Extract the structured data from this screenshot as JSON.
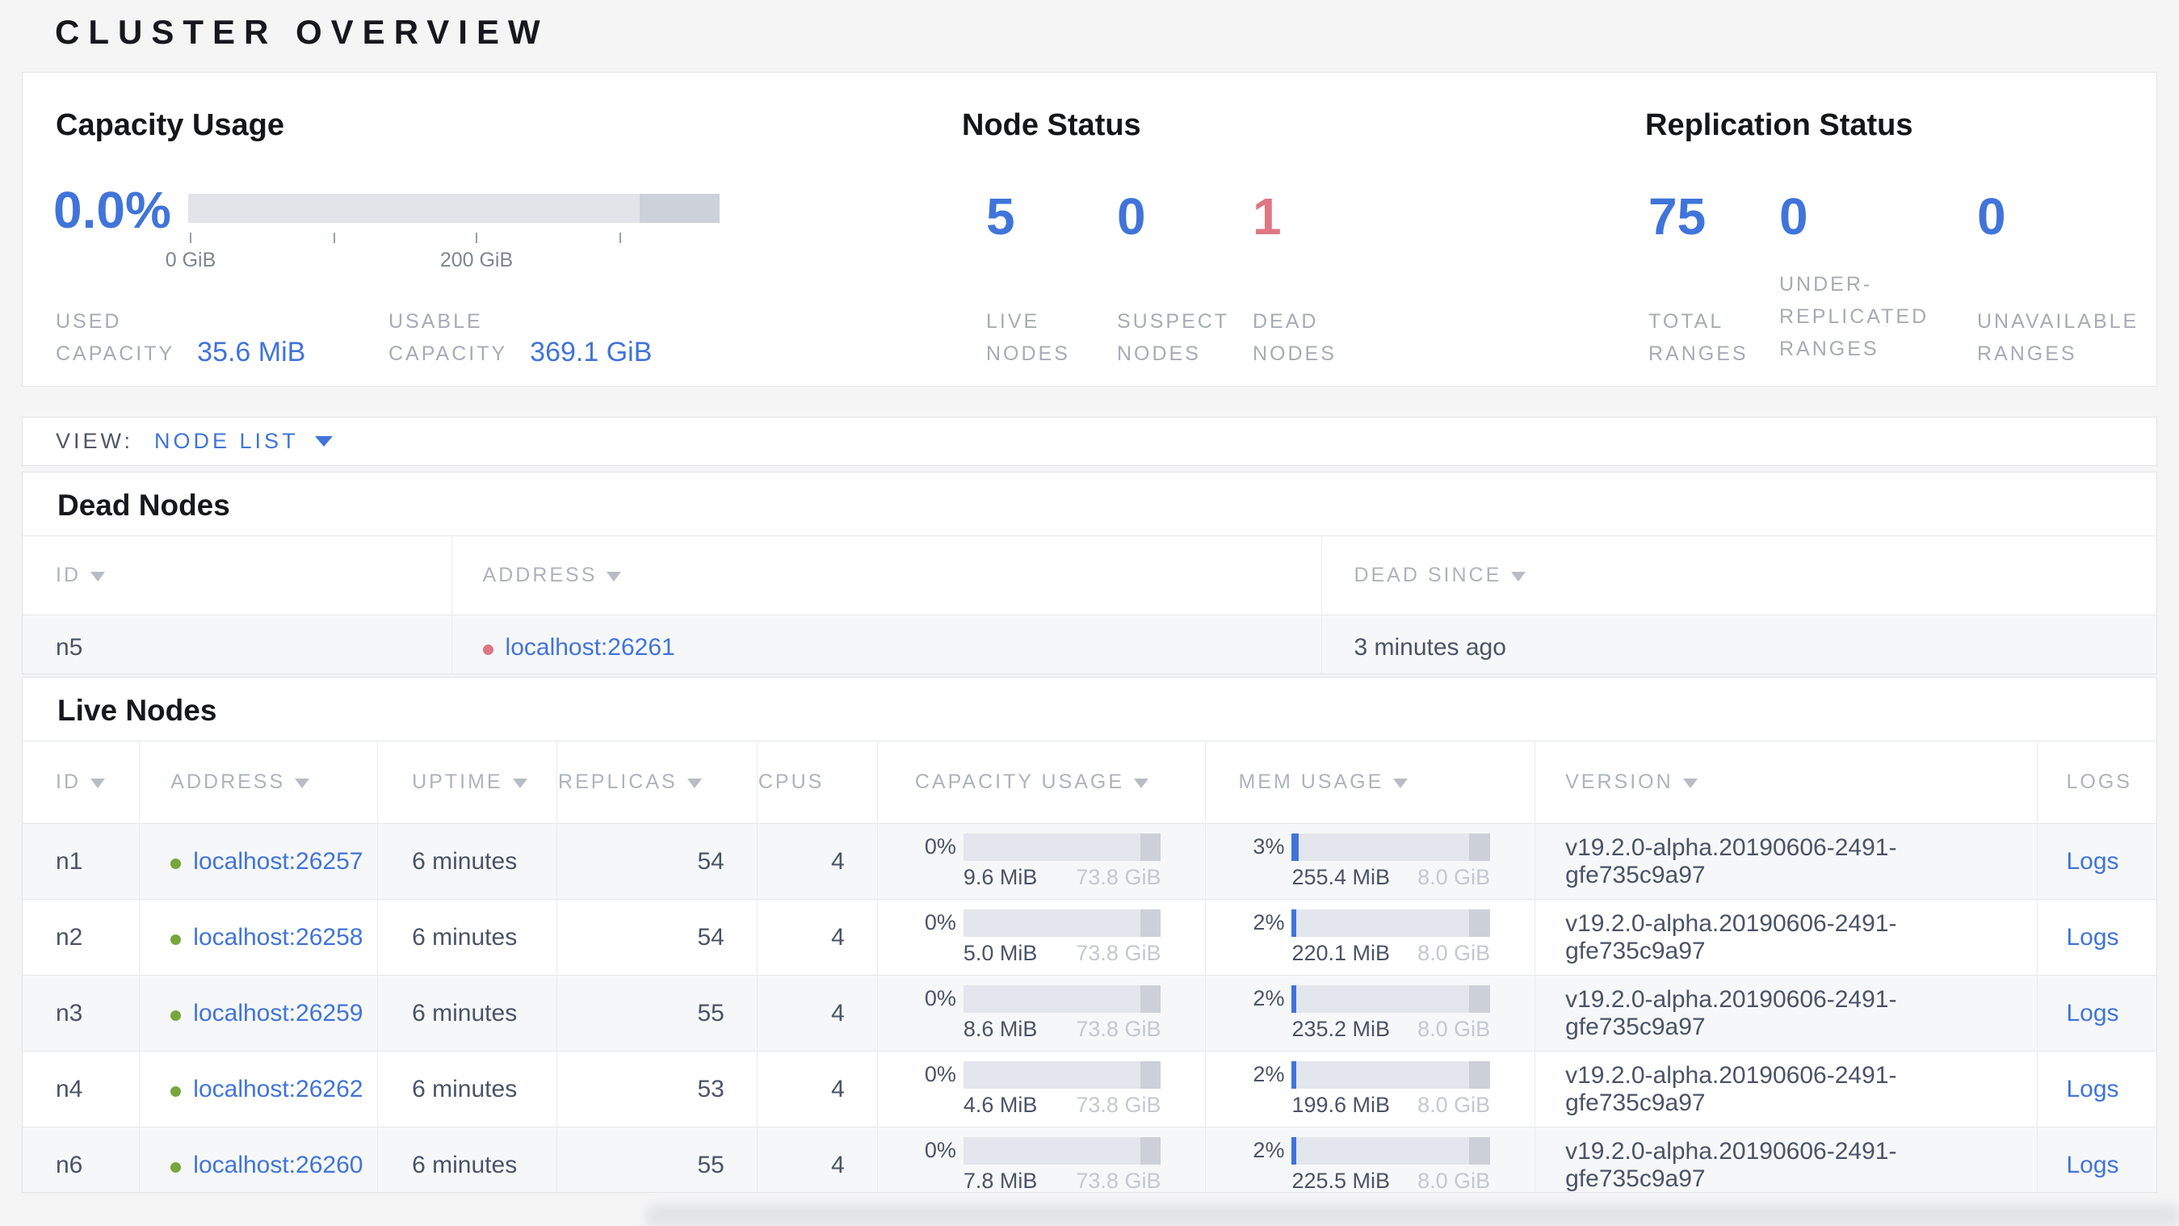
{
  "title": "CLUSTER OVERVIEW",
  "colors": {
    "accent": "#4074da",
    "danger": "#de7683",
    "live_dot": "#77a63c"
  },
  "summary": {
    "capacity": {
      "heading": "Capacity Usage",
      "percent": "0.0%",
      "tick_label_0": "0 GiB",
      "tick_label_200": "200 GiB",
      "used_label_line1": "USED",
      "used_label_line2": "CAPACITY",
      "used_value": "35.6 MiB",
      "usable_label_line1": "USABLE",
      "usable_label_line2": "CAPACITY",
      "usable_value": "369.1 GiB"
    },
    "node_status": {
      "heading": "Node Status",
      "stats": [
        {
          "value": "5",
          "label_line1": "LIVE",
          "label_line2": "NODES"
        },
        {
          "value": "0",
          "label_line1": "SUSPECT",
          "label_line2": "NODES"
        },
        {
          "value": "1",
          "label_line1": "DEAD",
          "label_line2": "NODES"
        }
      ]
    },
    "replication": {
      "heading": "Replication Status",
      "stats": [
        {
          "value": "75",
          "label_line1": "TOTAL",
          "label_line2": "RANGES"
        },
        {
          "value": "0",
          "label_line1": "UNDER-",
          "label_line2": "REPLICATED",
          "label_line3": "RANGES"
        },
        {
          "value": "0",
          "label_line1": "UNAVAILABLE",
          "label_line2": "RANGES"
        }
      ]
    }
  },
  "view_bar": {
    "label": "VIEW:",
    "selected": "NODE LIST"
  },
  "dead_nodes": {
    "heading": "Dead Nodes",
    "columns": {
      "id": "ID",
      "address": "ADDRESS",
      "dead_since": "DEAD SINCE"
    },
    "rows": [
      {
        "id": "n5",
        "address": "localhost:26261",
        "dead_since": "3 minutes ago"
      }
    ]
  },
  "live_nodes": {
    "heading": "Live Nodes",
    "columns": {
      "id": "ID",
      "address": "ADDRESS",
      "uptime": "UPTIME",
      "replicas": "REPLICAS",
      "cpus": "CPUS",
      "capacity": "CAPACITY USAGE",
      "mem": "MEM USAGE",
      "version": "VERSION",
      "logs": "LOGS"
    },
    "logs_label": "Logs",
    "rows": [
      {
        "id": "n1",
        "address": "localhost:26257",
        "uptime": "6 minutes",
        "replicas": "54",
        "cpus": "4",
        "capacity": {
          "percent": "0%",
          "used": "9.6 MiB",
          "total": "73.8 GiB"
        },
        "mem": {
          "percent": "3%",
          "used": "255.4 MiB",
          "total": "8.0 GiB"
        },
        "version": "v19.2.0-alpha.20190606-2491-gfe735c9a97"
      },
      {
        "id": "n2",
        "address": "localhost:26258",
        "uptime": "6 minutes",
        "replicas": "54",
        "cpus": "4",
        "capacity": {
          "percent": "0%",
          "used": "5.0 MiB",
          "total": "73.8 GiB"
        },
        "mem": {
          "percent": "2%",
          "used": "220.1 MiB",
          "total": "8.0 GiB"
        },
        "version": "v19.2.0-alpha.20190606-2491-gfe735c9a97"
      },
      {
        "id": "n3",
        "address": "localhost:26259",
        "uptime": "6 minutes",
        "replicas": "55",
        "cpus": "4",
        "capacity": {
          "percent": "0%",
          "used": "8.6 MiB",
          "total": "73.8 GiB"
        },
        "mem": {
          "percent": "2%",
          "used": "235.2 MiB",
          "total": "8.0 GiB"
        },
        "version": "v19.2.0-alpha.20190606-2491-gfe735c9a97"
      },
      {
        "id": "n4",
        "address": "localhost:26262",
        "uptime": "6 minutes",
        "replicas": "53",
        "cpus": "4",
        "capacity": {
          "percent": "0%",
          "used": "4.6 MiB",
          "total": "73.8 GiB"
        },
        "mem": {
          "percent": "2%",
          "used": "199.6 MiB",
          "total": "8.0 GiB"
        },
        "version": "v19.2.0-alpha.20190606-2491-gfe735c9a97"
      },
      {
        "id": "n6",
        "address": "localhost:26260",
        "uptime": "6 minutes",
        "replicas": "55",
        "cpus": "4",
        "capacity": {
          "percent": "0%",
          "used": "7.8 MiB",
          "total": "73.8 GiB"
        },
        "mem": {
          "percent": "2%",
          "used": "225.5 MiB",
          "total": "8.0 GiB"
        },
        "version": "v19.2.0-alpha.20190606-2491-gfe735c9a97"
      }
    ]
  }
}
